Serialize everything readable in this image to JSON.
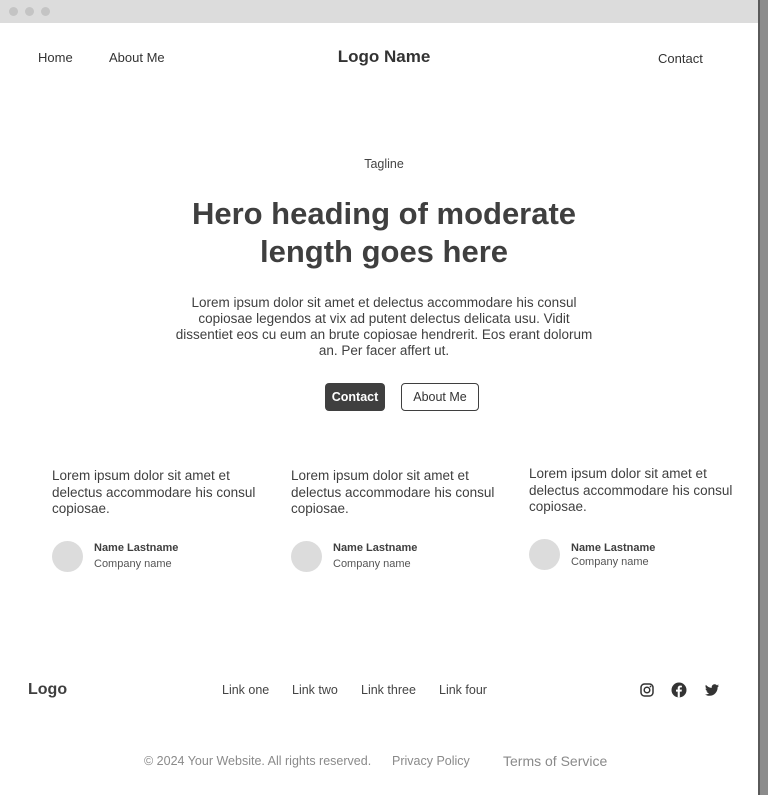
{
  "nav": {
    "home": "Home",
    "about": "About Me",
    "logo": "Logo Name",
    "contact": "Contact"
  },
  "hero": {
    "tagline": "Tagline",
    "heading": "Hero heading of moderate length goes here",
    "body": "Lorem ipsum dolor sit amet et delectus accommodare his consul copiosae legendos at vix ad putent delectus delicata usu. Vidit dissentiet eos cu eum an brute copiosae hendrerit. Eos erant dolorum an. Per facer affert ut.",
    "primary_button": "Contact",
    "secondary_button": "About Me"
  },
  "testimonials": [
    {
      "quote": "Lorem ipsum dolor sit amet et delectus accommodare his consul copiosae.",
      "name": "Name Lastname",
      "company": "Company name"
    },
    {
      "quote": "Lorem ipsum dolor sit amet et delectus accommodare his consul copiosae.",
      "name": "Name Lastname",
      "company": "Company name"
    },
    {
      "quote": "Lorem ipsum dolor sit amet et delectus accommodare his consul copiosae.",
      "name": "Name Lastname",
      "company": "Company name"
    }
  ],
  "footer": {
    "logo": "Logo",
    "links": [
      "Link one",
      "Link two",
      "Link three",
      "Link four"
    ],
    "social": [
      "instagram-icon",
      "facebook-icon",
      "twitter-icon"
    ],
    "copyright": "© 2024 Your Website. All rights reserved.",
    "privacy": "Privacy Policy",
    "terms": "Terms of Service"
  }
}
